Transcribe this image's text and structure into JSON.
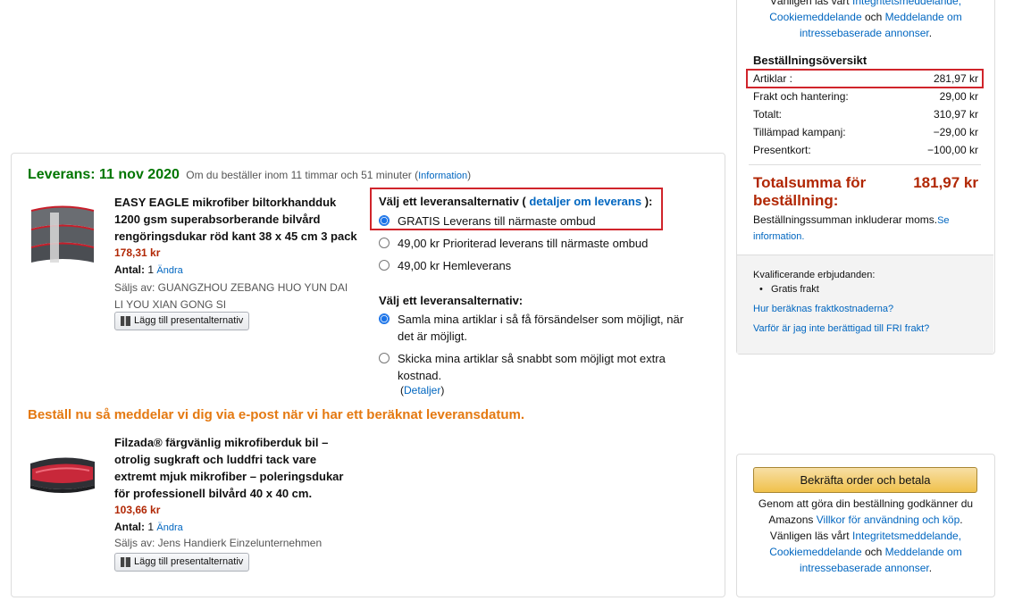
{
  "policy_top": {
    "line1": "Vänligen läs vårt ",
    "line1_link": "Integritetsmeddelande,",
    "link_cookie": "Cookiemeddelande",
    "and": " och ",
    "link_ads": "Meddelande om intressebaserade annonser",
    "end": "."
  },
  "summary": {
    "title": "Beställningsöversikt",
    "rows": [
      {
        "label": "Artiklar :",
        "value": "281,97 kr"
      },
      {
        "label": "Frakt och hantering:",
        "value": "29,00 kr"
      },
      {
        "label": "Totalt:",
        "value": "310,97 kr"
      },
      {
        "label": "Tillämpad kampanj:",
        "value": "−29,00 kr"
      },
      {
        "label": "Presentkort:",
        "value": "−100,00 kr"
      }
    ],
    "total_label": "Totalsumma för beställning:",
    "total_value": "181,97 kr",
    "note": "Beställningssumman inkluderar moms.",
    "note_link": "Se information."
  },
  "offers": {
    "title": "Kvalificerande erbjudanden:",
    "item": "Gratis frakt",
    "link1": "Hur beräknas fraktkostnaderna?",
    "link2": "Varför är jag inte berättigad till FRI frakt?"
  },
  "confirm": {
    "button": "Bekräfta order och betala",
    "text1": "Genom att göra din beställning godkänner du Amazons ",
    "link_terms": "Villkor för användning och köp",
    "text2": ". Vänligen läs vårt ",
    "link_privacy": "Integritetsmeddelande,",
    "link_cookie": "Cookiemeddelande",
    "and": " och ",
    "link_ads": "Meddelande om intressebaserade annonser",
    "end": "."
  },
  "shipment": {
    "date": "Leverans: 11 nov 2020",
    "countdown": "Om du beställer inom 11 timmar och 51 minuter (",
    "info_link": "Information",
    "close_paren": ")"
  },
  "products": [
    {
      "title": "EASY EAGLE mikrofiber biltorkhandduk 1200 gsm superabsorberande bilvård rengöringsdukar röd kant 38 x 45 cm 3 pack",
      "price": "178,31 kr",
      "qty_label": "Antal:",
      "qty": "1",
      "change": "Ändra",
      "seller": "Säljs av: GUANGZHOU ZEBANG HUO YUN DAI LI YOU XIAN GONG SI",
      "gift": "Lägg till presentalternativ"
    },
    {
      "title": "Filzada® färgvänlig mikrofiberduk bil – otrolig sugkraft och luddfri tack vare extremt mjuk mikrofiber – poleringsdukar för professionell bilvård 40 x 40 cm.",
      "price": "103,66 kr",
      "qty_label": "Antal:",
      "qty": "1",
      "change": "Ändra",
      "seller": "Säljs av: Jens Handierk Einzelunternehmen",
      "gift": "Lägg till presentalternativ"
    }
  ],
  "delivery_options": {
    "heading_pre": "Välj ett leveransalternativ ( ",
    "heading_link": "detaljer om leverans",
    "heading_post": " ):",
    "options": [
      {
        "label": "GRATIS Leverans till närmaste ombud",
        "selected": true
      },
      {
        "label": "49,00 kr Prioriterad leverans till närmaste ombud",
        "selected": false
      },
      {
        "label": "49,00 kr Hemleverans",
        "selected": false
      }
    ]
  },
  "shipping_speed": {
    "heading": "Välj ett leveransalternativ:",
    "options": [
      {
        "label": "Samla mina artiklar i så få försändelser som möjligt, när det är möjligt.",
        "selected": true
      },
      {
        "label": "Skicka mina artiklar så snabbt som möjligt mot extra kostnad.",
        "selected": false
      }
    ],
    "details_open": "(",
    "details_link": "Detaljer",
    "details_close": ")"
  },
  "notify_text": "Beställ nu så meddelar vi dig via e-post när vi har ett beräknat leveransdatum.",
  "colors": {
    "price": "#b12704",
    "delivery_date": "#007600",
    "notify": "#e47911",
    "link": "#0066c0",
    "highlight": "#d0242b"
  }
}
